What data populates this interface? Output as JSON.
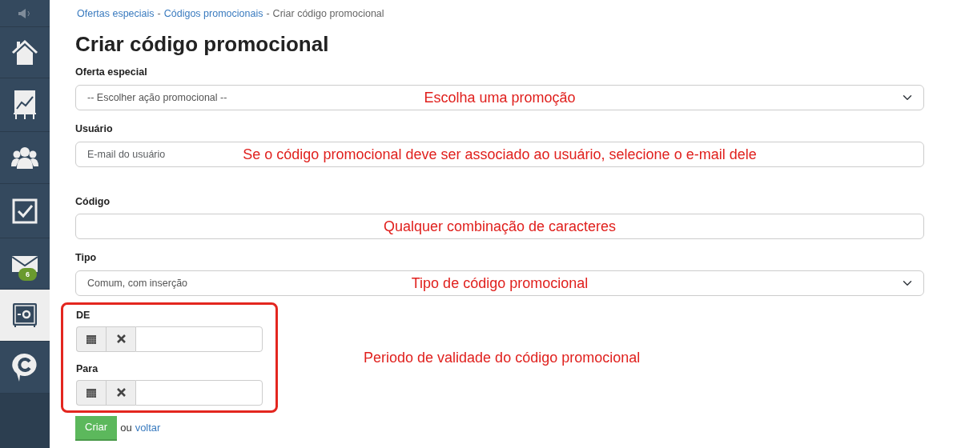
{
  "sidebar": {
    "items": [
      {
        "kind": "speaker",
        "selected": false
      },
      {
        "kind": "home",
        "selected": false
      },
      {
        "kind": "chart",
        "selected": false
      },
      {
        "kind": "users",
        "selected": false
      },
      {
        "kind": "check",
        "selected": false
      },
      {
        "kind": "mail",
        "selected": false,
        "badge": "6"
      },
      {
        "kind": "safe",
        "selected": true
      },
      {
        "kind": "chat",
        "selected": false
      }
    ]
  },
  "breadcrumb": [
    {
      "label": "Ofertas especiais",
      "current": false
    },
    {
      "label": "Códigos promocionais",
      "current": false
    },
    {
      "label": "Criar código promocional",
      "current": true
    }
  ],
  "breadcrumb_separator": "-",
  "title": "Criar código promocional",
  "fields": [
    {
      "kind": "select",
      "label": "Oferta especial",
      "value": "-- Escolher ação promocional --",
      "annotation": "Escolha uma promoção"
    },
    {
      "kind": "input",
      "label": "Usuário",
      "placeholder": "E-mail do usuário",
      "annotation": "Se o código promocional deve ser associado ao usuário, selecione o e-mail dele"
    },
    {
      "kind": "input",
      "label": "Código",
      "annotation": "Qualquer combinação de caracteres"
    },
    {
      "kind": "select",
      "label": "Tipo",
      "value": "Comum, com inserção",
      "annotation": "Tipo de código promocional"
    }
  ],
  "date_range": {
    "annotation": "Periodo de validade do código promocional",
    "fields": [
      {
        "label": "DE"
      },
      {
        "label": "Para"
      }
    ]
  },
  "actions": {
    "button": "Criar",
    "separator": "ou",
    "link": "voltar"
  }
}
